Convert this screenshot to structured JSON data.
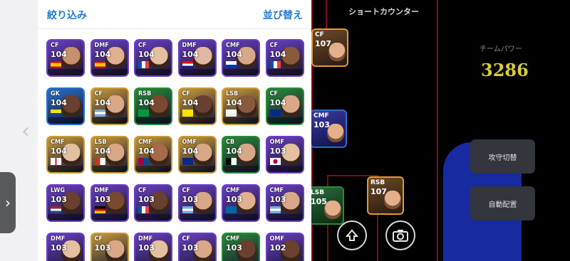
{
  "panel": {
    "filter_label": "絞り込み",
    "sort_label": "並び替え"
  },
  "cards": [
    {
      "pos": "CF",
      "rating": "104",
      "color": "#6a3fc2",
      "flag": "spain",
      "skin": "#c6906a"
    },
    {
      "pos": "DMF",
      "rating": "104",
      "color": "#6a3fc2",
      "flag": "spain",
      "skin": "#e0b090"
    },
    {
      "pos": "CF",
      "rating": "104",
      "color": "#6a3fc2",
      "flag": "france",
      "skin": "#e3c0a0"
    },
    {
      "pos": "DMF",
      "rating": "104",
      "color": "#6a3fc2",
      "flag": "croatia",
      "skin": "#e3b8a0"
    },
    {
      "pos": "CMF",
      "rating": "104",
      "color": "#6a3fc2",
      "flag": "uruguay",
      "skin": "#d8a888"
    },
    {
      "pos": "CF",
      "rating": "104",
      "color": "#6a3fc2",
      "flag": "france",
      "skin": "#8a5a3c"
    },
    {
      "pos": "GK",
      "rating": "104",
      "color": "#2a6fc8",
      "flag": "parma",
      "skin": "#6a4030"
    },
    {
      "pos": "CF",
      "rating": "104",
      "color": "#c89a3a",
      "flag": "argentina",
      "skin": "#d8a888"
    },
    {
      "pos": "RSB",
      "rating": "104",
      "color": "#2a8a3a",
      "flag": "brazil",
      "skin": "#7a4a30"
    },
    {
      "pos": "CF",
      "rating": "104",
      "color": "#c89a3a",
      "flag": "dortmund",
      "skin": "#6a4030"
    },
    {
      "pos": "LSB",
      "rating": "104",
      "color": "#c89a3a",
      "flag": "real",
      "skin": "#8a5a3c"
    },
    {
      "pos": "CF",
      "rating": "104",
      "color": "#2a8a3a",
      "flag": "inter",
      "skin": "#d8a888"
    },
    {
      "pos": "CMF",
      "rating": "104",
      "color": "#c89a3a",
      "flag": "england",
      "skin": "#e3c0a0"
    },
    {
      "pos": "LSB",
      "rating": "104",
      "color": "#c89a3a",
      "flag": "atletico",
      "skin": "#d8a888"
    },
    {
      "pos": "CMF",
      "rating": "104",
      "color": "#c89a3a",
      "flag": "barcelona",
      "skin": "#a86a48"
    },
    {
      "pos": "OMF",
      "rating": "104",
      "color": "#c89a3a",
      "flag": "inter",
      "skin": "#d8a888"
    },
    {
      "pos": "CB",
      "rating": "104",
      "color": "#2a8a3a",
      "flag": "juventus",
      "skin": "#d8a888"
    },
    {
      "pos": "OMF",
      "rating": "103",
      "color": "#6a3fc2",
      "flag": "japan",
      "skin": "#e3c0a0"
    },
    {
      "pos": "LWG",
      "rating": "103",
      "color": "#6a3fc2",
      "flag": "netherlands",
      "skin": "#6a4030"
    },
    {
      "pos": "DMF",
      "rating": "103",
      "color": "#6a3fc2",
      "flag": "germany",
      "skin": "#7a4a30"
    },
    {
      "pos": "CF",
      "rating": "103",
      "color": "#6a3fc2",
      "flag": "france",
      "skin": "#6a4030"
    },
    {
      "pos": "CF",
      "rating": "103",
      "color": "#6a3fc2",
      "flag": "argentina",
      "skin": "#d8a888"
    },
    {
      "pos": "CMF",
      "rating": "103",
      "color": "#6a3fc2",
      "flag": "sweden",
      "skin": "#e0b090"
    },
    {
      "pos": "CMF",
      "rating": "103",
      "color": "#6a3fc2",
      "flag": "argentina",
      "skin": "#d8a888"
    },
    {
      "pos": "DMF",
      "rating": "103",
      "color": "#6a3fc2",
      "flag": "none",
      "skin": "#e3c0a0"
    },
    {
      "pos": "CF",
      "rating": "103",
      "color": "#c89a3a",
      "flag": "none",
      "skin": "#d8a888"
    },
    {
      "pos": "DMF",
      "rating": "103",
      "color": "#6a3fc2",
      "flag": "none",
      "skin": "#e3c0a0"
    },
    {
      "pos": "CF",
      "rating": "103",
      "color": "#6a3fc2",
      "flag": "none",
      "skin": "#d8a888"
    },
    {
      "pos": "CMF",
      "rating": "103",
      "color": "#2a8a3a",
      "flag": "none",
      "skin": "#6a4030"
    },
    {
      "pos": "OMF",
      "rating": "102",
      "color": "#6a3fc2",
      "flag": "none",
      "skin": "#6a4030"
    }
  ],
  "field": {
    "title": "ショートカウンター",
    "team_power_label": "チームパワー",
    "team_power_value": "3286",
    "attack_defense_label": "攻守切替",
    "auto_position_label": "自動配置",
    "field_cards": [
      {
        "pos": "CF",
        "rating": "107"
      },
      {
        "pos": "CMF",
        "rating": "103"
      },
      {
        "pos": "RSB",
        "rating": "107"
      },
      {
        "pos": "LSB",
        "rating": "105"
      }
    ]
  }
}
